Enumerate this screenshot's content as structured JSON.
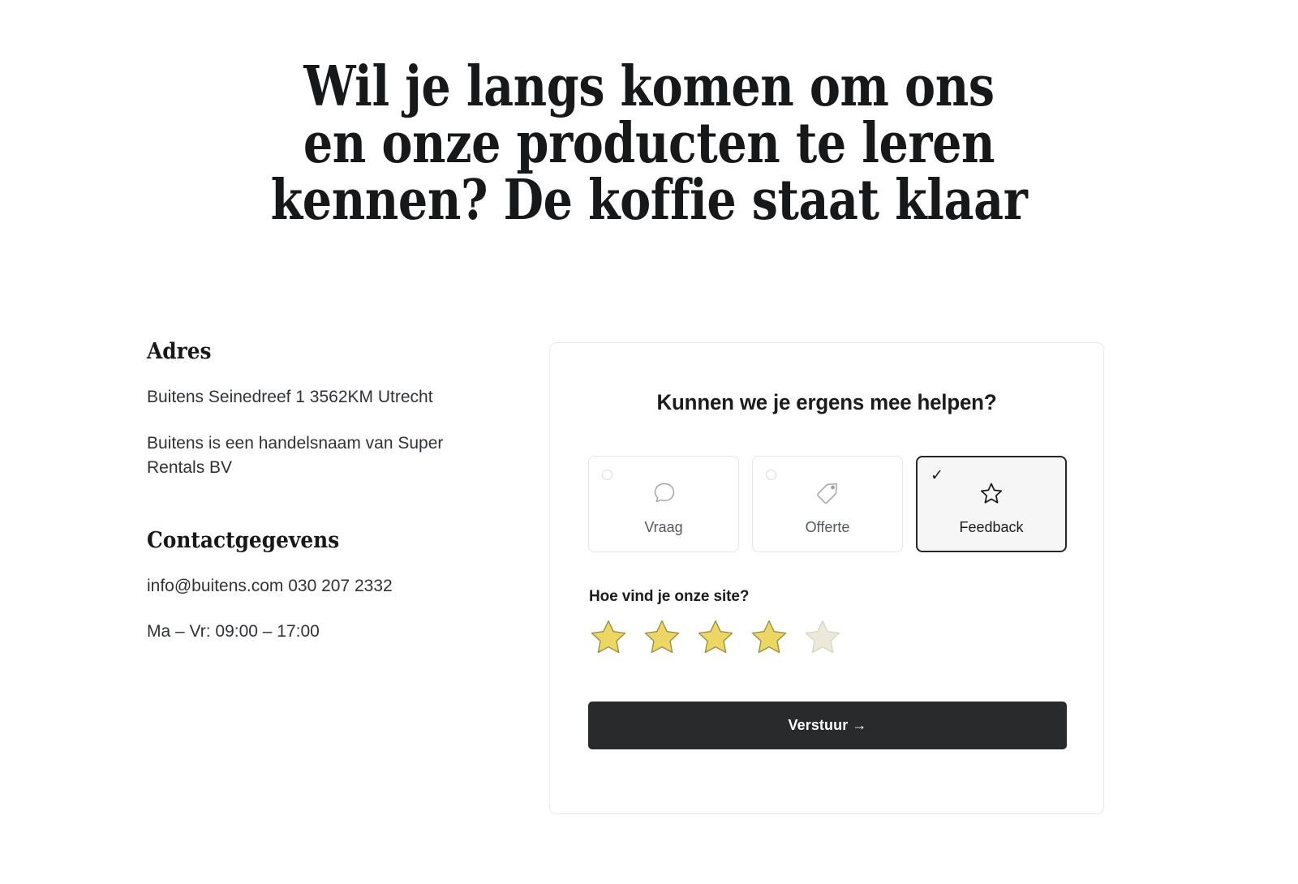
{
  "hero": {
    "title": "Wil je langs komen om ons en onze producten te leren kennen? De koffie staat klaar"
  },
  "info": {
    "address_heading": "Adres",
    "address_lines": "Buitens\nSeinedreef 1\n3562KM Utrecht",
    "legal_lines": "Buitens is een handelsnaam\nvan Super Rentals BV",
    "contact_heading": "Contactgegevens",
    "contact_lines": "info@buitens.com\n030 207 2332",
    "hours": "Ma – Vr: 09:00 – 17:00"
  },
  "form": {
    "title": "Kunnen we je ergens mee helpen?",
    "options": [
      {
        "label": "Vraag",
        "icon": "speech-bubble-icon",
        "selected": false
      },
      {
        "label": "Offerte",
        "icon": "price-tag-icon",
        "selected": false
      },
      {
        "label": "Feedback",
        "icon": "star-outline-icon",
        "selected": true
      }
    ],
    "rating_label": "Hoe vind je onze site?",
    "rating_value": 4,
    "rating_max": 5,
    "submit_label": "Verstuur →"
  },
  "colors": {
    "text": "#1c1c1c",
    "muted_text": "#55585c",
    "card_border": "#e9e9e9",
    "selected_border": "#26272a",
    "selected_fill": "#f6f6f6",
    "button_bg": "#292a2c",
    "star_filled": "#ecd765",
    "star_filled_stroke": "#9a8b3e",
    "star_empty": "#ece9d9",
    "star_empty_stroke": "#d8d5c6"
  }
}
